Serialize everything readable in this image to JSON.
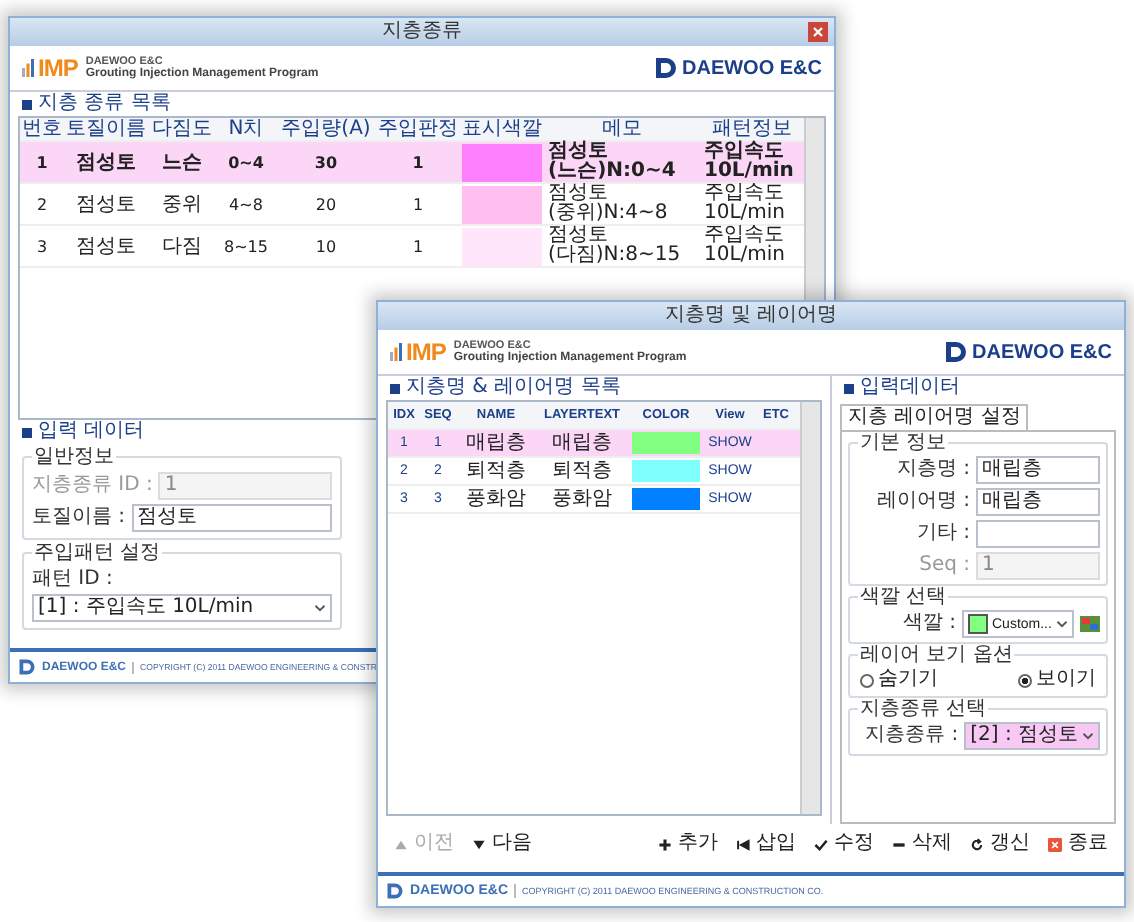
{
  "back_window": {
    "title": "지층종류",
    "logo_mark": "IMP",
    "company_small": "DAEWOO E&C",
    "program_name": "Grouting Injection Management Program",
    "company_logo": "DAEWOO E&C",
    "list_title": "지층 종류 목록",
    "columns": [
      "번호",
      "토질이름",
      "다짐도",
      "N치",
      "주입량(A)",
      "주입판정",
      "표시색깔",
      "메모",
      "패턴정보"
    ],
    "rows": [
      {
        "cells": [
          "1",
          "점성토",
          "느슨",
          "0~4",
          "30",
          "1"
        ],
        "color": "#ff80ff",
        "memo": "점성토(느슨)N:0~4",
        "pattern": "주입속도 10L/min",
        "selected": true
      },
      {
        "cells": [
          "2",
          "점성토",
          "중위",
          "4~8",
          "20",
          "1"
        ],
        "color": "#ffc0f0",
        "memo": "점성토(중위)N:4~8",
        "pattern": "주입속도 10L/min",
        "selected": false
      },
      {
        "cells": [
          "3",
          "점성토",
          "다짐",
          "8~15",
          "10",
          "1"
        ],
        "color": "#ffe6fa",
        "memo": "점성토(다짐)N:8~15",
        "pattern": "주입속도 10L/min",
        "selected": false
      }
    ],
    "input_title": "입력 데이터",
    "general_group": {
      "title": "일반정보",
      "fields": [
        {
          "label": "지층종류 ID :",
          "value": "1",
          "disabled": true
        },
        {
          "label": "토질이름 :",
          "value": "점성토",
          "disabled": false
        }
      ]
    },
    "pattern_group": {
      "title": "주입패턴 설정",
      "label": "패턴 ID :",
      "value": "[1] : 주입속도 10L/min"
    },
    "footer": {
      "logo": "DAEWOO E&C",
      "copyright": "COPYRIGHT (C) 2011 DAEWOO ENGINEERING & CONSTR"
    }
  },
  "front_window": {
    "title": "지층명 및 레이어명",
    "logo_mark": "IMP",
    "company_small": "DAEWOO E&C",
    "program_name": "Grouting Injection Management Program",
    "company_logo": "DAEWOO E&C",
    "list_title": "지층명 & 레이어명 목록",
    "columns": [
      "IDX",
      "SEQ",
      "NAME",
      "LAYERTEXT",
      "COLOR",
      "View",
      "ETC"
    ],
    "rows": [
      {
        "idx": "1",
        "seq": "1",
        "name": "매립층",
        "layertext": "매립층",
        "color": "#80ff80",
        "view": "SHOW",
        "selected": true
      },
      {
        "idx": "2",
        "seq": "2",
        "name": "퇴적층",
        "layertext": "퇴적층",
        "color": "#80ffff",
        "view": "SHOW",
        "selected": false
      },
      {
        "idx": "3",
        "seq": "3",
        "name": "풍화암",
        "layertext": "풍화암",
        "color": "#0080ff",
        "view": "SHOW",
        "selected": false
      }
    ],
    "input_title": "입력데이터",
    "tabs": [
      {
        "label": "지층 레이어명 설정",
        "selected": true
      }
    ],
    "basic_group": {
      "title": "기본 정보",
      "fields": [
        {
          "label": "지층명 :",
          "value": "매립층",
          "disabled": false
        },
        {
          "label": "레이어명 :",
          "value": "매립층",
          "disabled": false
        },
        {
          "label": "기타 :",
          "disabled": false
        },
        {
          "label": "Seq :",
          "value": "1",
          "disabled": true
        }
      ]
    },
    "color_group": {
      "title": "색깔 선택",
      "label": "색깔 :",
      "color": "#80ff80",
      "value": "Custom..."
    },
    "view_group": {
      "title": "레이어 보기 옵션",
      "options": [
        {
          "label": "숨기기",
          "selected": false
        },
        {
          "label": "보이기",
          "selected": true
        }
      ]
    },
    "strata_group": {
      "title": "지층종류 선택",
      "label": "지층종류 :",
      "value": "[2] : 점성토"
    },
    "toolbar": [
      {
        "label": "이전",
        "kind": "up",
        "disabled": true
      },
      {
        "label": "다음",
        "kind": "down",
        "disabled": false
      },
      {
        "label": "추가",
        "kind": "add",
        "disabled": false
      },
      {
        "label": "삽입",
        "kind": "insert",
        "disabled": false
      },
      {
        "label": "수정",
        "kind": "edit",
        "disabled": false
      },
      {
        "label": "삭제",
        "kind": "delete",
        "disabled": false
      },
      {
        "label": "갱신",
        "kind": "refresh",
        "disabled": false
      },
      {
        "label": "종료",
        "kind": "exit",
        "disabled": false
      }
    ],
    "footer": {
      "logo": "DAEWOO E&C",
      "copyright": "COPYRIGHT (C) 2011 DAEWOO ENGINEERING & CONSTRUCTION CO."
    }
  }
}
